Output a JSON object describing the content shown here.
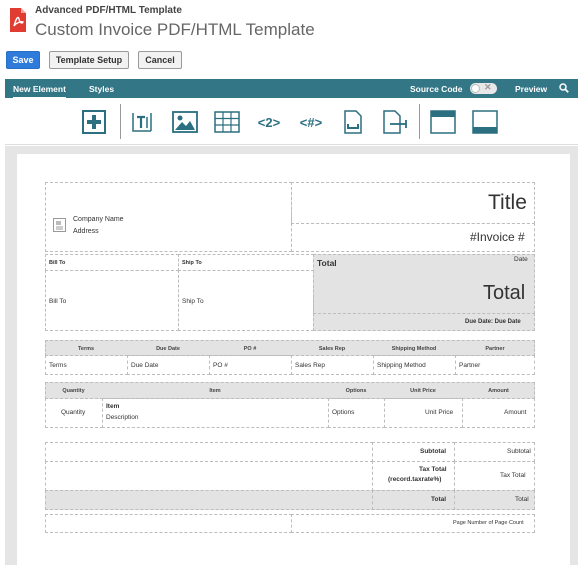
{
  "header": {
    "app_title": "Advanced PDF/HTML Template",
    "page_title": "Custom Invoice PDF/HTML Template"
  },
  "actions": {
    "save": "Save",
    "template_setup": "Template Setup",
    "cancel": "Cancel"
  },
  "nav": {
    "tabs": [
      "New Element",
      "Styles"
    ],
    "source_code": "Source Code",
    "preview": "Preview"
  },
  "toolbar": {
    "field_label": "<2>",
    "expression_label": "<#>",
    "icons": [
      "add-element-icon",
      "text-icon",
      "image-icon",
      "table-icon",
      "field-icon",
      "expression-icon",
      "page-break-icon",
      "page-number-icon",
      "header-icon",
      "footer-icon"
    ]
  },
  "template": {
    "company_name": "Company Name",
    "address": "Address",
    "title": "Title",
    "invoice_no": "#Invoice #",
    "bill_to_label": "Bill To",
    "ship_to_label": "Ship To",
    "total_label": "Total",
    "date": "Date",
    "bill_to": "Bill To",
    "ship_to": "Ship To",
    "total_big": "Total",
    "due_date": "Due Date: Due Date",
    "info_headers": [
      "Terms",
      "Due Date",
      "PO #",
      "Sales Rep",
      "Shipping Method",
      "Partner"
    ],
    "info_values": [
      "Terms",
      "Due Date",
      "PO #",
      "Sales Rep",
      "Shipping Method",
      "Partner"
    ],
    "item_headers": [
      "Quantity",
      "Item",
      "Options",
      "Unit Price",
      "Amount"
    ],
    "item_row": {
      "quantity": "Quantity",
      "item": "Item",
      "description": "Description",
      "options": "Options",
      "unit_price": "Unit Price",
      "amount": "Amount"
    },
    "subtotal_label": "Subtotal",
    "subtotal_value": "Subtotal",
    "tax_label_1": "Tax Total",
    "tax_label_2": "(record.taxrate%)",
    "tax_value": "Tax Total",
    "total_label2": "Total",
    "total_value": "Total",
    "page_number": "Page Number of Page Count"
  }
}
